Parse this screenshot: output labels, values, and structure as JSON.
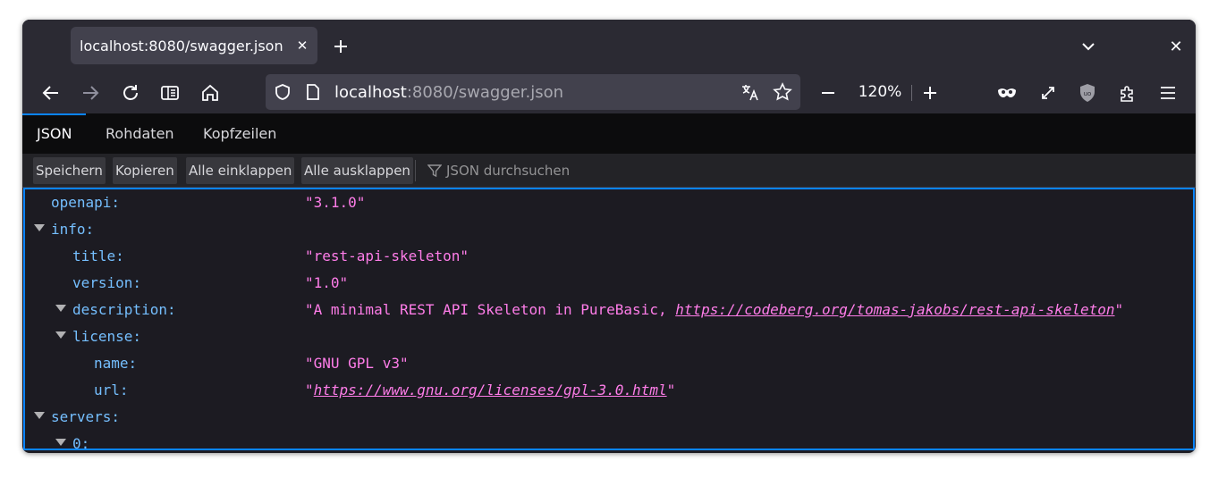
{
  "tab": {
    "title": "localhost:8080/swagger.json"
  },
  "url": {
    "host": "localhost",
    "rest": ":8080/swagger.json"
  },
  "zoom": {
    "level": "120%"
  },
  "viewer_tabs": [
    "JSON",
    "Rohdaten",
    "Kopfzeilen"
  ],
  "toolbar": {
    "save": "Speichern",
    "copy": "Kopieren",
    "collapse_all": "Alle einklappen",
    "expand_all": "Alle ausklappen",
    "filter_placeholder": "JSON durchsuchen"
  },
  "rows": {
    "openapi": {
      "key": "openapi:",
      "value": "\"3.1.0\""
    },
    "info": {
      "key": "info:"
    },
    "title": {
      "key": "title:",
      "value": "\"rest-api-skeleton\""
    },
    "version": {
      "key": "version:",
      "value": "\"1.0\""
    },
    "description": {
      "key": "description:",
      "value_prefix": "\"A minimal REST API Skeleton in PureBasic, ",
      "value_link": "https://codeberg.org/tomas-jakobs/rest-api-skeleton",
      "value_suffix": "\""
    },
    "license": {
      "key": "license:"
    },
    "name": {
      "key": "name:",
      "value": "\"GNU GPL v3\""
    },
    "url": {
      "key": "url:",
      "value_prefix": "\"",
      "value_link": "https://www.gnu.org/licenses/gpl-3.0.html",
      "value_suffix": "\""
    },
    "servers": {
      "key": "servers:"
    },
    "server0": {
      "key": "0:"
    }
  },
  "colors": {
    "accent": "#0a84ff",
    "key": "#75bfff",
    "string": "#ff7de9",
    "chrome": "#2b2a33"
  }
}
